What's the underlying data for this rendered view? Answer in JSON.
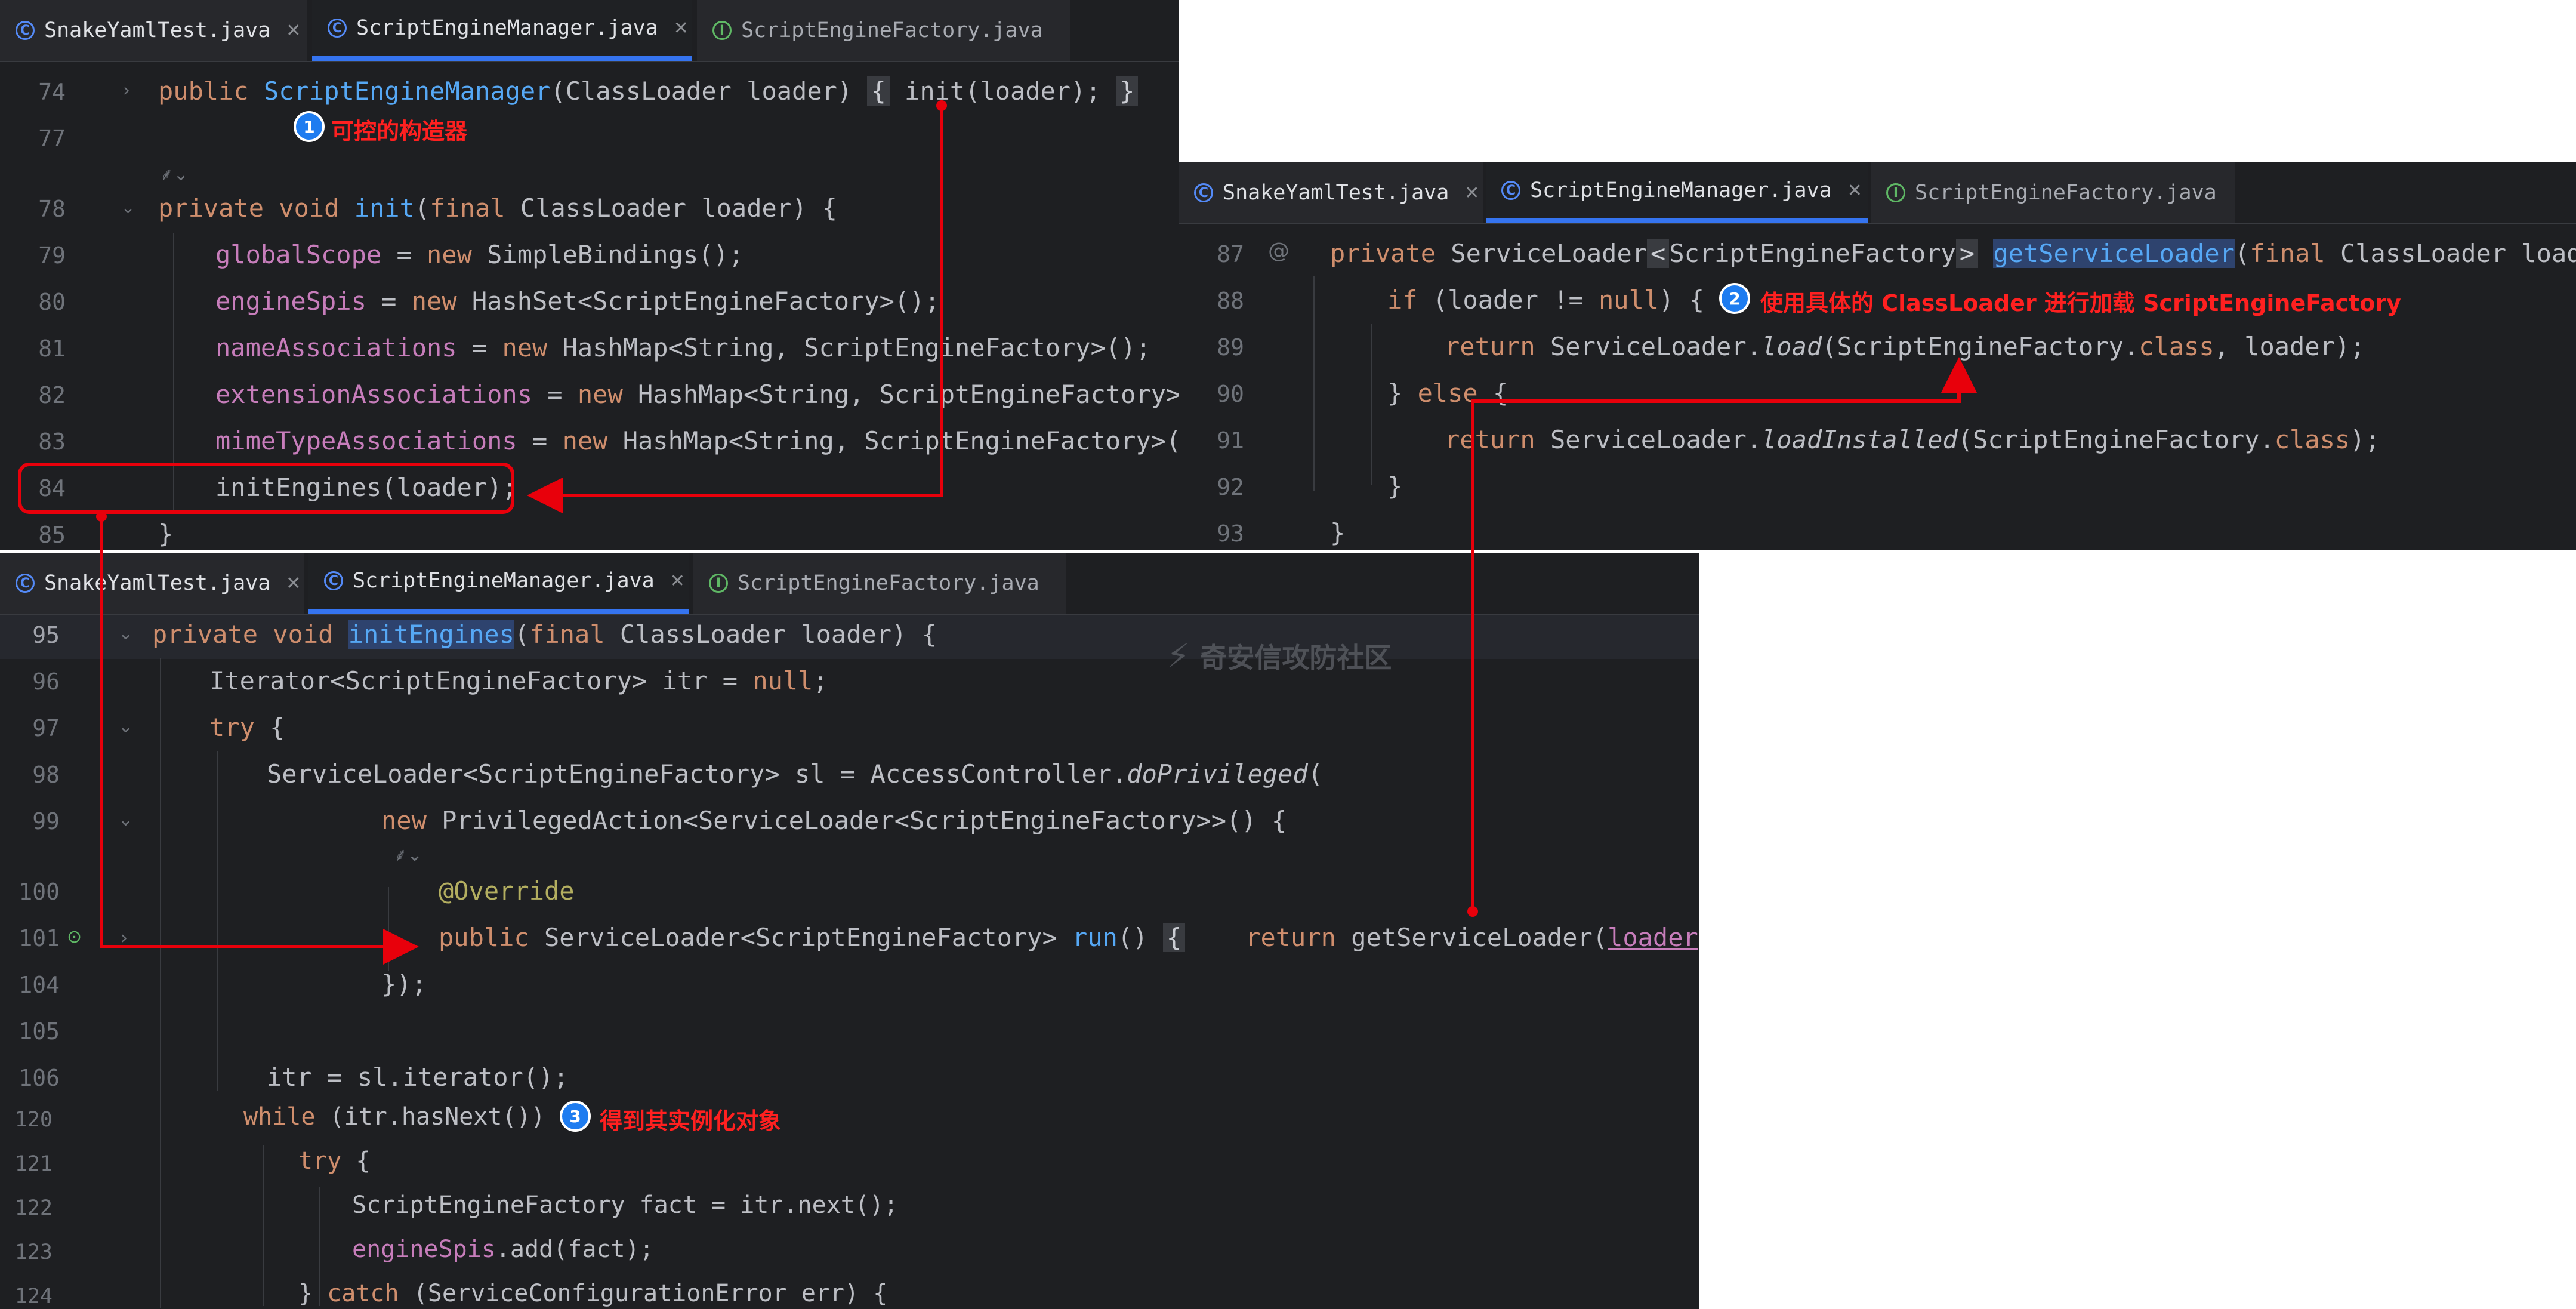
{
  "tabs": {
    "snake": "SnakeYamlTest.java",
    "manager": "ScriptEngineManager.java",
    "factory": "ScriptEngineFactory.java"
  },
  "panel1": {
    "line_numbers": [
      "74",
      "77",
      "78",
      "79",
      "80",
      "81",
      "82",
      "83",
      "84",
      "85"
    ]
  },
  "panel2": {
    "line_numbers": [
      "87",
      "88",
      "89",
      "90",
      "91",
      "92",
      "93"
    ]
  },
  "panel3": {
    "line_numbers": [
      "95",
      "96",
      "97",
      "98",
      "99",
      "100",
      "101",
      "104",
      "105",
      "106",
      "120",
      "121",
      "122",
      "123",
      "124"
    ]
  },
  "annotations": {
    "one_num": "1",
    "one_text": "可控的构造器",
    "two_num": "2",
    "two_text": "使用具体的 ClassLoader 进行加载 ScriptEngineFactory",
    "three_num": "3",
    "three_text": "得到其实例化对象"
  },
  "watermark": "奇安信攻防社区",
  "colors": {
    "editor_bg": "#1e1f22",
    "keyword": "#cf8e6d",
    "method": "#56a8f5",
    "field": "#c77dbb",
    "annotation": "#b3ae60",
    "arrow_red": "#e8000b",
    "badge_blue": "#1e7cf0"
  }
}
